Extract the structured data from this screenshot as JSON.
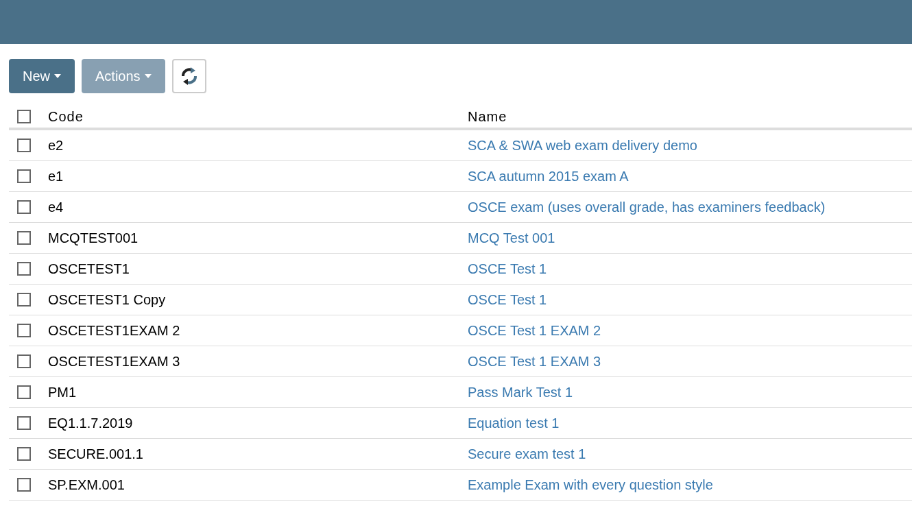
{
  "toolbar": {
    "buttons": [
      {
        "label": "New",
        "disabled": false
      },
      {
        "label": "Actions",
        "disabled": true
      }
    ]
  },
  "table": {
    "columns": [
      "Code",
      "Name"
    ],
    "select_all": {
      "checked": false
    },
    "rows": [
      {
        "code": "e2",
        "name": "SCA & SWA web exam delivery demo",
        "checked": false
      },
      {
        "code": "e1",
        "name": "SCA autumn 2015 exam A",
        "checked": false
      },
      {
        "code": "e4",
        "name": "OSCE exam (uses overall grade, has examiners feedback)",
        "checked": false
      },
      {
        "code": "MCQTEST001",
        "name": "MCQ Test 001",
        "checked": false
      },
      {
        "code": "OSCETEST1",
        "name": "OSCE Test 1",
        "checked": false
      },
      {
        "code": "OSCETEST1 Copy",
        "name": "OSCE Test 1",
        "checked": false
      },
      {
        "code": "OSCETEST1EXAM 2",
        "name": "OSCE Test 1 EXAM 2",
        "checked": false
      },
      {
        "code": "OSCETEST1EXAM 3",
        "name": "OSCE Test 1 EXAM 3",
        "checked": false
      },
      {
        "code": "PM1",
        "name": "Pass Mark Test 1",
        "checked": false
      },
      {
        "code": "EQ1.1.7.2019",
        "name": "Equation test 1",
        "checked": false
      },
      {
        "code": "SECURE.001.1",
        "name": "Secure exam test 1",
        "checked": false
      },
      {
        "code": "SP.EXM.001",
        "name": "Example Exam with every question style",
        "checked": false
      }
    ]
  }
}
